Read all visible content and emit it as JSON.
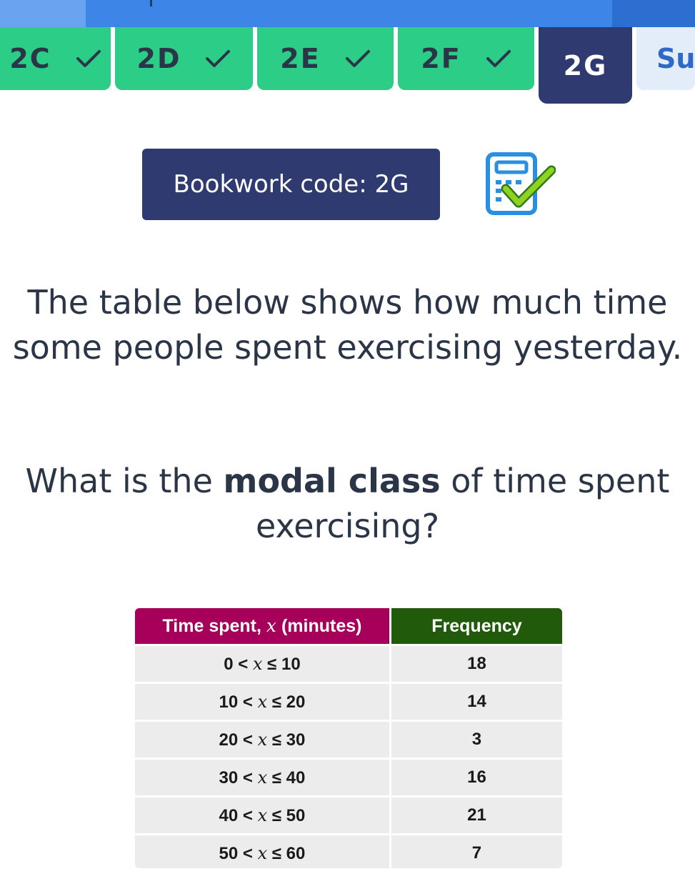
{
  "tabs": [
    {
      "label": "2C",
      "status": "done"
    },
    {
      "label": "2D",
      "status": "done"
    },
    {
      "label": "2E",
      "status": "done"
    },
    {
      "label": "2F",
      "status": "done"
    },
    {
      "label": "2G",
      "status": "current"
    },
    {
      "label": "Su",
      "status": "summary"
    }
  ],
  "bookwork": {
    "label": "Bookwork code: 2G",
    "icon": "calculator-allowed-icon"
  },
  "question": {
    "intro": "The table below shows how much time some people spent exercising yesterday.",
    "prompt_before": "What is the ",
    "prompt_bold": "modal class",
    "prompt_after": " of time spent exercising?"
  },
  "table": {
    "headers": {
      "time_prefix": "Time spent, ",
      "time_var": "x",
      "time_suffix": " (minutes)",
      "frequency": "Frequency"
    },
    "rows": [
      {
        "low": "0",
        "high": "10",
        "frequency": "18"
      },
      {
        "low": "10",
        "high": "20",
        "frequency": "14"
      },
      {
        "low": "20",
        "high": "30",
        "frequency": "3"
      },
      {
        "low": "30",
        "high": "40",
        "frequency": "16"
      },
      {
        "low": "40",
        "high": "50",
        "frequency": "21"
      },
      {
        "low": "50",
        "high": "60",
        "frequency": "7"
      }
    ],
    "var": "x",
    "lt": "<",
    "le": "≤"
  },
  "colors": {
    "done_tab": "#2ccd86",
    "current_tab": "#2f3a70",
    "summary_tab": "#e3edf9",
    "time_header": "#a6005a",
    "frequency_header": "#225a0c",
    "progress_bar": "#3d86e8"
  }
}
